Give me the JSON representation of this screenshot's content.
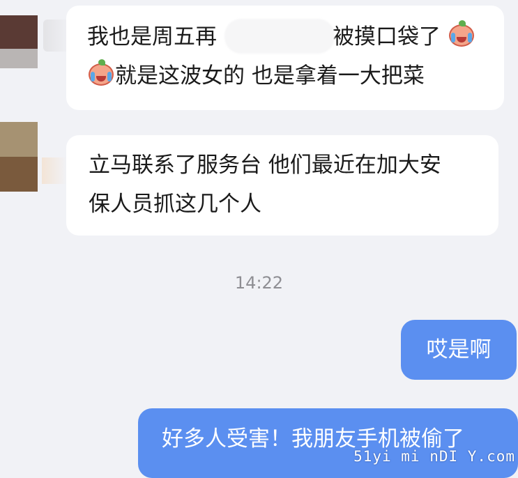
{
  "messages": [
    {
      "side": "left",
      "lines": [
        "我也是周五再",
        "被摸口袋了",
        "就是这波女的 也是拿着一大把菜"
      ]
    },
    {
      "side": "left",
      "lines": [
        "立马联系了服务台 他们最近在加大安",
        "保人员抓这几个人"
      ]
    }
  ],
  "timestamp": "14:22",
  "sent": [
    "哎是啊",
    "好多人受害！我朋友手机被偷了"
  ],
  "watermark": "51yi mi nDI Y.com",
  "colors": {
    "background": "#f1f2f6",
    "sent_bubble": "#5b8ff0",
    "received_bubble": "#ffffff"
  },
  "icons": {
    "emoji": "crying-face-icon"
  }
}
